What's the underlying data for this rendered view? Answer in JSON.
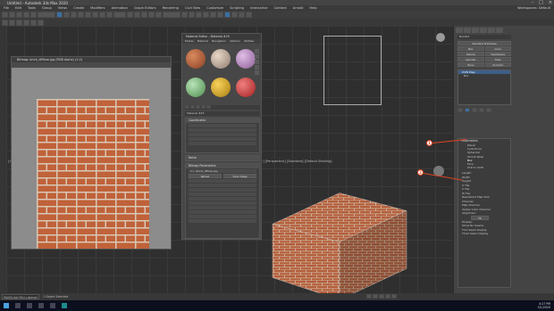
{
  "window": {
    "title": "Untitled - Autodesk 3ds Max 2020"
  },
  "menubar": [
    "File",
    "Edit",
    "Tools",
    "Group",
    "Views",
    "Create",
    "Modifiers",
    "Animation",
    "Graph Editors",
    "Rendering",
    "Civil View",
    "Customize",
    "Scripting",
    "Interactive",
    "Content",
    "Arnold",
    "Help"
  ],
  "toolbar": {
    "workspace_label": "Workspaces: Default"
  },
  "viewport": {
    "top_left_label": "[+] [Top] [Standard] [Wireframe]",
    "perspective_label": "[+] [Perspective] [Standard] [Default Shading]",
    "left_label": "[+]"
  },
  "image_window": {
    "title": "Bitmap: brick_diffuse.jpg (RGB Alpha) (1:2)"
  },
  "material_editor": {
    "title": "Material Editor - Material #25",
    "menu": [
      "Modes",
      "Material",
      "Navigation",
      "Options",
      "Utilities"
    ],
    "material_name": "Material #25",
    "material_type": "Standard (Legacy)",
    "rollouts": [
      "Coordinates",
      "Noise",
      "Bitmap Parameters"
    ],
    "bitmap_path": "C:\\...\\brick_diffuse.jpg",
    "buttons": [
      "Reload",
      "View Image"
    ]
  },
  "command_panel": {
    "object_name": "Box001",
    "buttons": [
      "Standard Primitives",
      "Box",
      "Cone",
      "Sphere",
      "GeoSphere",
      "Cylinder",
      "Tube",
      "Torus",
      "Pyramid",
      "Teapot",
      "Plane",
      "TextPlus"
    ],
    "stack_item": "UVW Map",
    "stack_sub": "Box",
    "parameters_title": "Parameters",
    "mapping_options": [
      "Planar",
      "Cylindrical",
      "Spherical",
      "Shrink Wrap",
      "Box",
      "Face",
      "XYZ to UVW"
    ],
    "fields": [
      "Length",
      "Width",
      "Height",
      "U Tile",
      "V Tile",
      "W Tile"
    ],
    "checkbox_real_world": "Real-World Map Size",
    "channel_label": "Channel:",
    "map_channel": "Map Channel",
    "vertex_color": "Vertex Color Channel",
    "alignment_label": "Alignment",
    "fit_button": "Fit",
    "display_label": "Display:",
    "display_options": [
      "Show No Seams",
      "Thin Seam Display",
      "Thick Seam Display"
    ]
  },
  "callouts": [
    "1",
    "2"
  ],
  "statusbar": {
    "selection_text": "1 Object Selected",
    "script_text": "MAXScript Mini-Listener"
  },
  "taskbar": {
    "time": "4:27 PM",
    "date": "5/1/2020"
  },
  "colors": {
    "brick": "#c0623a",
    "mortar": "#d8c8b6",
    "accent": "#3b6ea5",
    "callout": "#dd4422"
  }
}
